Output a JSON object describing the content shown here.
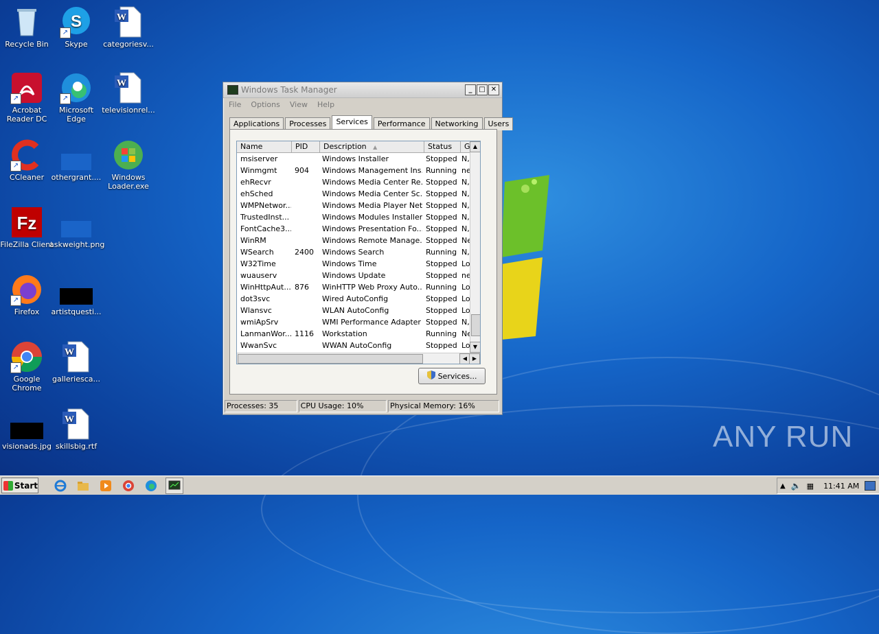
{
  "desktop": {
    "icons": [
      {
        "label": "Recycle Bin"
      },
      {
        "label": "Skype"
      },
      {
        "label": "categoriesv..."
      },
      {
        "label": "Acrobat Reader DC"
      },
      {
        "label": "Microsoft Edge"
      },
      {
        "label": "televisionrel..."
      },
      {
        "label": "CCleaner"
      },
      {
        "label": "othergrant...."
      },
      {
        "label": "Windows Loader.exe"
      },
      {
        "label": "FileZilla Client"
      },
      {
        "label": "askweight.png"
      },
      {
        "label": "Firefox"
      },
      {
        "label": "artistquesti..."
      },
      {
        "label": "Google Chrome"
      },
      {
        "label": "galleriesca..."
      },
      {
        "label": "visionads.jpg"
      },
      {
        "label": "skillsbig.rtf"
      }
    ],
    "watermark": "ANY RUN"
  },
  "window": {
    "title": "Windows Task Manager",
    "menu": [
      "File",
      "Options",
      "View",
      "Help"
    ],
    "tabs": [
      "Applications",
      "Processes",
      "Services",
      "Performance",
      "Networking",
      "Users"
    ],
    "active_tab": "Services",
    "columns": [
      "Name",
      "PID",
      "Description",
      "Status",
      "G"
    ],
    "rows": [
      {
        "name": "msiserver",
        "pid": "",
        "desc": "Windows Installer",
        "status": "Stopped",
        "g": "N,"
      },
      {
        "name": "Winmgmt",
        "pid": "904",
        "desc": "Windows Management Ins...",
        "status": "Running",
        "g": "ne"
      },
      {
        "name": "ehRecvr",
        "pid": "",
        "desc": "Windows Media Center Re...",
        "status": "Stopped",
        "g": "N,"
      },
      {
        "name": "ehSched",
        "pid": "",
        "desc": "Windows Media Center Sc...",
        "status": "Stopped",
        "g": "N,"
      },
      {
        "name": "WMPNetwor...",
        "pid": "",
        "desc": "Windows Media Player Net...",
        "status": "Stopped",
        "g": "N,"
      },
      {
        "name": "TrustedInst...",
        "pid": "",
        "desc": "Windows Modules Installer",
        "status": "Stopped",
        "g": "N,"
      },
      {
        "name": "FontCache3...",
        "pid": "",
        "desc": "Windows Presentation Fo...",
        "status": "Stopped",
        "g": "N,"
      },
      {
        "name": "WinRM",
        "pid": "",
        "desc": "Windows Remote Manage...",
        "status": "Stopped",
        "g": "Ne"
      },
      {
        "name": "WSearch",
        "pid": "2400",
        "desc": "Windows Search",
        "status": "Running",
        "g": "N,"
      },
      {
        "name": "W32Time",
        "pid": "",
        "desc": "Windows Time",
        "status": "Stopped",
        "g": "Lo"
      },
      {
        "name": "wuauserv",
        "pid": "",
        "desc": "Windows Update",
        "status": "Stopped",
        "g": "ne"
      },
      {
        "name": "WinHttpAut...",
        "pid": "876",
        "desc": "WinHTTP Web Proxy Auto...",
        "status": "Running",
        "g": "Lo"
      },
      {
        "name": "dot3svc",
        "pid": "",
        "desc": "Wired AutoConfig",
        "status": "Stopped",
        "g": "Lo"
      },
      {
        "name": "Wlansvc",
        "pid": "",
        "desc": "WLAN AutoConfig",
        "status": "Stopped",
        "g": "Lo"
      },
      {
        "name": "wmiApSrv",
        "pid": "",
        "desc": "WMI Performance Adapter",
        "status": "Stopped",
        "g": "N,"
      },
      {
        "name": "LanmanWor...",
        "pid": "1116",
        "desc": "Workstation",
        "status": "Running",
        "g": "Ne"
      },
      {
        "name": "WwanSvc",
        "pid": "",
        "desc": "WWAN AutoConfig",
        "status": "Stopped",
        "g": "Lo"
      }
    ],
    "services_button": "Services...",
    "status": {
      "processes": "Processes: 35",
      "cpu": "CPU Usage: 10%",
      "memory": "Physical Memory: 16%"
    }
  },
  "taskbar": {
    "start_label": "Start",
    "clock": "11:41 AM"
  }
}
